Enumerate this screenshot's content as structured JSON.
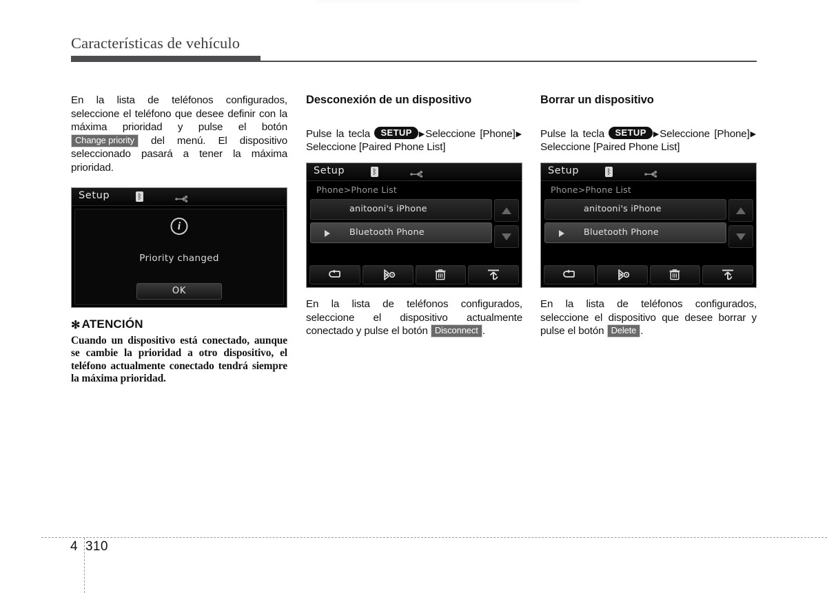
{
  "header": {
    "title": "Características de vehículo"
  },
  "footer": {
    "chapter": "4",
    "page": "310"
  },
  "columns": [
    {
      "id": "column-change-priority",
      "title": null,
      "intro": {
        "pre": "En la lista de teléfonos configurados, seleccione el teléfono que desee definir con la máxima prioridad y pulse el botón",
        "chip": "Change priority",
        "post": "del menú. El dispositivo seleccionado pasará a tener la máxima prioridad."
      },
      "screen": {
        "type": "dialog",
        "title": "Setup",
        "icons": [
          "bluetooth-icon",
          "usb-icon"
        ],
        "info_glyph": "i",
        "message": "Priority changed",
        "ok_label": "OK"
      },
      "notice": {
        "star": "✻",
        "heading": "ATENCIÓN",
        "body": "Cuando un dispositivo está conectado, aunque se cambie la prioridad a otro dispositivo, el teléfono actualmente conectado tendrá siempre la máxima prioridad."
      }
    },
    {
      "id": "column-disconnect",
      "title": "Desconexión de un dispositivo",
      "path": {
        "pre": "Pulse la tecla",
        "key": "SETUP",
        "mid": "Seleccione [Phone]",
        "post": "Seleccione [Paired Phone List]"
      },
      "screen": {
        "type": "list",
        "title": "Setup",
        "icons": [
          "bluetooth-icon",
          "usb-icon"
        ],
        "breadcrumb": "Phone>Phone List",
        "rows": [
          {
            "label": "anitooni's iPhone",
            "selected": false,
            "marker": false
          },
          {
            "label": "Bluetooth Phone",
            "selected": true,
            "marker": true
          }
        ],
        "scroll": [
          "scroll-up-button",
          "scroll-down-button"
        ],
        "toolbar": [
          "back-icon",
          "bluetooth-settings-icon",
          "delete-icon",
          "priority-icon"
        ]
      },
      "outro": {
        "pre": "En la lista de teléfonos configurados, seleccione el dispositivo actualmente conectado y pulse el botón",
        "chip": "Disconnect",
        "post": "."
      }
    },
    {
      "id": "column-delete",
      "title": "Borrar un dispositivo",
      "path": {
        "pre": "Pulse la tecla",
        "key": "SETUP",
        "mid": "Seleccione [Phone]",
        "post": "Seleccione [Paired Phone List]"
      },
      "screen": {
        "type": "list",
        "title": "Setup",
        "icons": [
          "bluetooth-icon",
          "usb-icon"
        ],
        "breadcrumb": "Phone>Phone List",
        "rows": [
          {
            "label": "anitooni's iPhone",
            "selected": false,
            "marker": false
          },
          {
            "label": "Bluetooth Phone",
            "selected": true,
            "marker": true
          }
        ],
        "scroll": [
          "scroll-up-button",
          "scroll-down-button"
        ],
        "toolbar": [
          "back-icon",
          "bluetooth-settings-icon",
          "delete-icon",
          "priority-icon"
        ]
      },
      "outro": {
        "pre": "En la lista de teléfonos configurados, seleccione el dispositivo que desee borrar y pulse el botón",
        "chip": "Delete",
        "post": "."
      }
    }
  ],
  "glyphs": {
    "bluetooth": "ᛒ",
    "triangle_right": "▶"
  },
  "colors": {
    "rule": "#4d4d4f",
    "chip_bg": "#6a6a6a",
    "key_bg": "#111111",
    "screen_bg": "#000000"
  }
}
